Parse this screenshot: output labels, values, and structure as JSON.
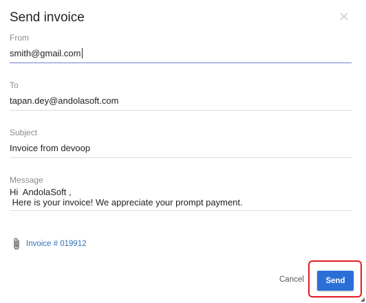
{
  "dialog": {
    "title": "Send invoice"
  },
  "form": {
    "from": {
      "label": "From",
      "value": "smith@gmail.com"
    },
    "to": {
      "label": "To",
      "value": "tapan.dey@andolasoft.com"
    },
    "subject": {
      "label": "Subject",
      "value": "Invoice from devoop"
    },
    "message": {
      "label": "Message",
      "line1": "Hi  AndolaSoft ,",
      "line2": " Here is your invoice! We appreciate your prompt payment."
    }
  },
  "attachment": {
    "label": "Invoice # 019912",
    "icon": "paperclip-icon"
  },
  "actions": {
    "cancel_label": "Cancel",
    "send_label": "Send"
  },
  "colors": {
    "accent": "#2a6fd6",
    "focus_underline": "#6c7fd6",
    "link": "#2e6fb7",
    "highlight": "#e0191f"
  }
}
